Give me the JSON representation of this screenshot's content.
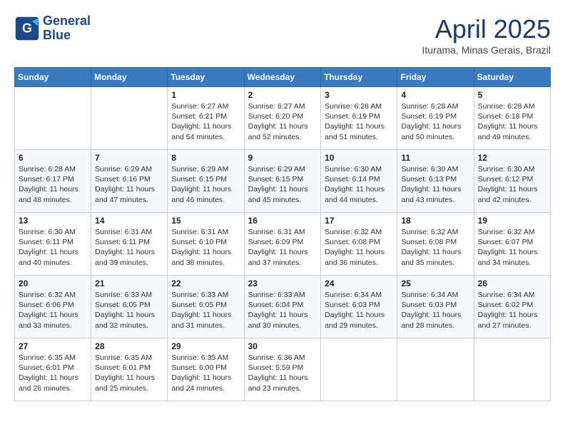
{
  "header": {
    "logo_line1": "General",
    "logo_line2": "Blue",
    "month_title": "April 2025",
    "location": "Iturama, Minas Gerais, Brazil"
  },
  "columns": [
    "Sunday",
    "Monday",
    "Tuesday",
    "Wednesday",
    "Thursday",
    "Friday",
    "Saturday"
  ],
  "weeks": [
    [
      {
        "day": "",
        "detail": ""
      },
      {
        "day": "",
        "detail": ""
      },
      {
        "day": "1",
        "detail": "Sunrise: 6:27 AM\nSunset: 6:21 PM\nDaylight: 11 hours and 54 minutes."
      },
      {
        "day": "2",
        "detail": "Sunrise: 6:27 AM\nSunset: 6:20 PM\nDaylight: 11 hours and 52 minutes."
      },
      {
        "day": "3",
        "detail": "Sunrise: 6:28 AM\nSunset: 6:19 PM\nDaylight: 11 hours and 51 minutes."
      },
      {
        "day": "4",
        "detail": "Sunrise: 6:28 AM\nSunset: 6:19 PM\nDaylight: 11 hours and 50 minutes."
      },
      {
        "day": "5",
        "detail": "Sunrise: 6:28 AM\nSunset: 6:18 PM\nDaylight: 11 hours and 49 minutes."
      }
    ],
    [
      {
        "day": "6",
        "detail": "Sunrise: 6:28 AM\nSunset: 6:17 PM\nDaylight: 11 hours and 48 minutes."
      },
      {
        "day": "7",
        "detail": "Sunrise: 6:29 AM\nSunset: 6:16 PM\nDaylight: 11 hours and 47 minutes."
      },
      {
        "day": "8",
        "detail": "Sunrise: 6:29 AM\nSunset: 6:15 PM\nDaylight: 11 hours and 46 minutes."
      },
      {
        "day": "9",
        "detail": "Sunrise: 6:29 AM\nSunset: 6:15 PM\nDaylight: 11 hours and 45 minutes."
      },
      {
        "day": "10",
        "detail": "Sunrise: 6:30 AM\nSunset: 6:14 PM\nDaylight: 11 hours and 44 minutes."
      },
      {
        "day": "11",
        "detail": "Sunrise: 6:30 AM\nSunset: 6:13 PM\nDaylight: 11 hours and 43 minutes."
      },
      {
        "day": "12",
        "detail": "Sunrise: 6:30 AM\nSunset: 6:12 PM\nDaylight: 11 hours and 42 minutes."
      }
    ],
    [
      {
        "day": "13",
        "detail": "Sunrise: 6:30 AM\nSunset: 6:11 PM\nDaylight: 11 hours and 40 minutes."
      },
      {
        "day": "14",
        "detail": "Sunrise: 6:31 AM\nSunset: 6:11 PM\nDaylight: 11 hours and 39 minutes."
      },
      {
        "day": "15",
        "detail": "Sunrise: 6:31 AM\nSunset: 6:10 PM\nDaylight: 11 hours and 38 minutes."
      },
      {
        "day": "16",
        "detail": "Sunrise: 6:31 AM\nSunset: 6:09 PM\nDaylight: 11 hours and 37 minutes."
      },
      {
        "day": "17",
        "detail": "Sunrise: 6:32 AM\nSunset: 6:08 PM\nDaylight: 11 hours and 36 minutes."
      },
      {
        "day": "18",
        "detail": "Sunrise: 6:32 AM\nSunset: 6:08 PM\nDaylight: 11 hours and 35 minutes."
      },
      {
        "day": "19",
        "detail": "Sunrise: 6:32 AM\nSunset: 6:07 PM\nDaylight: 11 hours and 34 minutes."
      }
    ],
    [
      {
        "day": "20",
        "detail": "Sunrise: 6:32 AM\nSunset: 6:06 PM\nDaylight: 11 hours and 33 minutes."
      },
      {
        "day": "21",
        "detail": "Sunrise: 6:33 AM\nSunset: 6:05 PM\nDaylight: 11 hours and 32 minutes."
      },
      {
        "day": "22",
        "detail": "Sunrise: 6:33 AM\nSunset: 6:05 PM\nDaylight: 11 hours and 31 minutes."
      },
      {
        "day": "23",
        "detail": "Sunrise: 6:33 AM\nSunset: 6:04 PM\nDaylight: 11 hours and 30 minutes."
      },
      {
        "day": "24",
        "detail": "Sunrise: 6:34 AM\nSunset: 6:03 PM\nDaylight: 11 hours and 29 minutes."
      },
      {
        "day": "25",
        "detail": "Sunrise: 6:34 AM\nSunset: 6:03 PM\nDaylight: 11 hours and 28 minutes."
      },
      {
        "day": "26",
        "detail": "Sunrise: 6:34 AM\nSunset: 6:02 PM\nDaylight: 11 hours and 27 minutes."
      }
    ],
    [
      {
        "day": "27",
        "detail": "Sunrise: 6:35 AM\nSunset: 6:01 PM\nDaylight: 11 hours and 26 minutes."
      },
      {
        "day": "28",
        "detail": "Sunrise: 6:35 AM\nSunset: 6:01 PM\nDaylight: 11 hours and 25 minutes."
      },
      {
        "day": "29",
        "detail": "Sunrise: 6:35 AM\nSunset: 6:00 PM\nDaylight: 11 hours and 24 minutes."
      },
      {
        "day": "30",
        "detail": "Sunrise: 6:36 AM\nSunset: 5:59 PM\nDaylight: 11 hours and 23 minutes."
      },
      {
        "day": "",
        "detail": ""
      },
      {
        "day": "",
        "detail": ""
      },
      {
        "day": "",
        "detail": ""
      }
    ]
  ]
}
